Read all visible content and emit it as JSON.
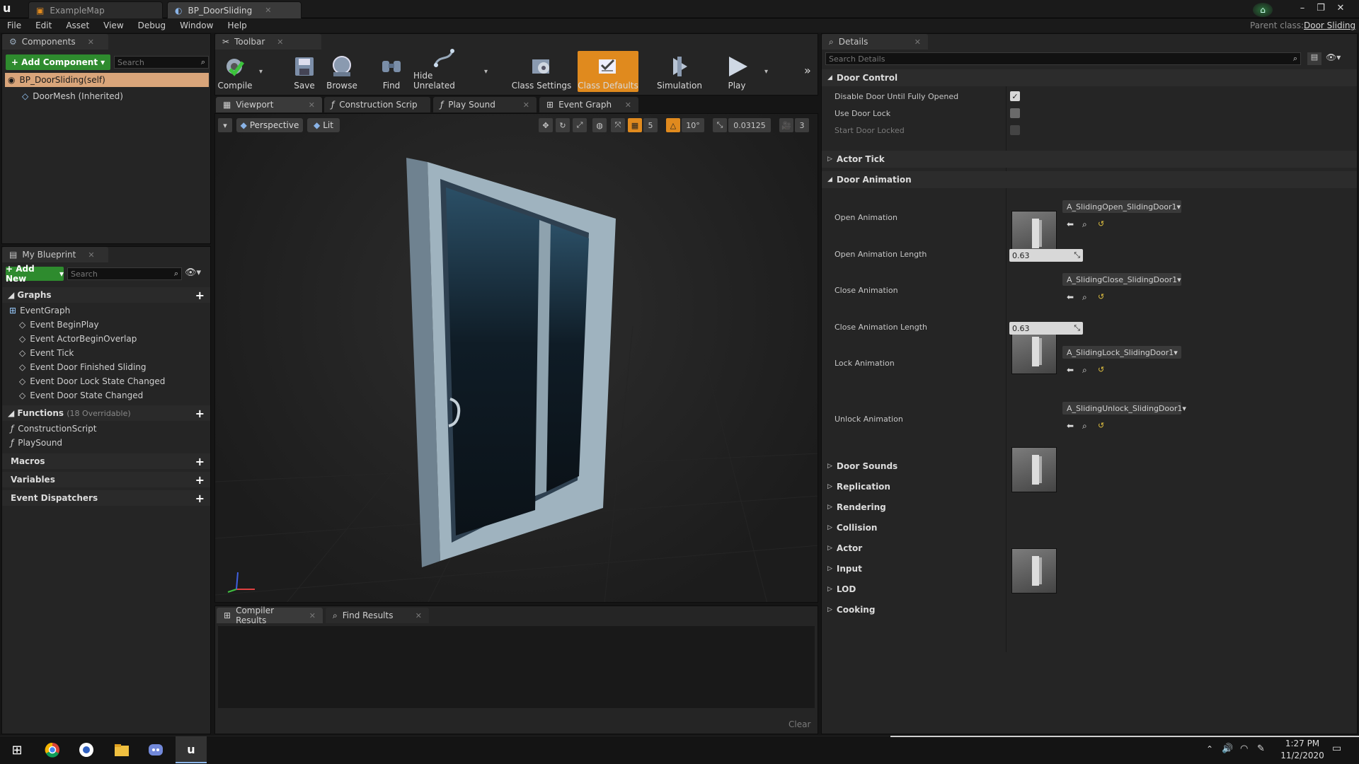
{
  "title_tabs": [
    {
      "label": "ExampleMap"
    },
    {
      "label": "BP_DoorSliding"
    }
  ],
  "parent_class": {
    "label": "Parent class:",
    "value": "Door Sliding"
  },
  "menu": [
    "File",
    "Edit",
    "Asset",
    "View",
    "Debug",
    "Window",
    "Help"
  ],
  "components": {
    "tab": "Components",
    "add_label": "+ Add Component",
    "search_placeholder": "Search",
    "root": "BP_DoorSliding(self)",
    "child": "DoorMesh (Inherited)"
  },
  "my_blueprint": {
    "tab": "My Blueprint",
    "add_label": "+ Add New",
    "search_placeholder": "Search",
    "graphs_header": "Graphs",
    "event_graph": "EventGraph",
    "events": [
      "Event BeginPlay",
      "Event ActorBeginOverlap",
      "Event Tick",
      "Event Door Finished Sliding",
      "Event Door Lock State Changed",
      "Event Door State Changed"
    ],
    "functions_header": "Functions",
    "functions_count": "(18 Overridable)",
    "functions": [
      "ConstructionScript",
      "PlaySound"
    ],
    "macros": "Macros",
    "variables": "Variables",
    "dispatchers": "Event Dispatchers"
  },
  "toolbar": {
    "tab": "Toolbar",
    "buttons": [
      "Compile",
      "Save",
      "Browse",
      "Find",
      "Hide Unrelated",
      "Class Settings",
      "Class Defaults",
      "Simulation",
      "Play"
    ]
  },
  "editor_tabs": [
    "Viewport",
    "Construction Scrip",
    "Play Sound",
    "Event Graph"
  ],
  "viewport": {
    "perspective": "Perspective",
    "lit": "Lit",
    "grid_snap": "5",
    "rot_snap": "10°",
    "scale_snap": "0.03125",
    "cam_speed": "3"
  },
  "bottom_tabs": [
    "Compiler Results",
    "Find Results"
  ],
  "clear_label": "Clear",
  "details": {
    "tab": "Details",
    "search_placeholder": "Search Details",
    "door_control": "Door Control",
    "props": [
      {
        "label": "Disable Door Until Fully Opened",
        "checked": true
      },
      {
        "label": "Use Door Lock",
        "checked": false
      },
      {
        "label": "Start Door Locked",
        "checked": false
      }
    ],
    "actor_tick": "Actor Tick",
    "door_animation": "Door Animation",
    "open_anim_label": "Open Animation",
    "open_anim_asset": "A_SlidingOpen_SlidingDoor1",
    "open_len_label": "Open Animation Length",
    "open_len_value": "0.63",
    "close_anim_label": "Close Animation",
    "close_anim_asset": "A_SlidingClose_SlidingDoor1",
    "close_len_label": "Close Animation Length",
    "close_len_value": "0.63",
    "lock_anim_label": "Lock Animation",
    "lock_anim_asset": "A_SlidingLock_SlidingDoor1",
    "unlock_anim_label": "Unlock Animation",
    "unlock_anim_asset": "A_SlidingUnlock_SlidingDoor1",
    "collapsed_sections": [
      "Door Sounds",
      "Replication",
      "Rendering",
      "Collision",
      "Actor",
      "Input",
      "LOD",
      "Cooking"
    ]
  },
  "taskbar": {
    "time": "1:27 PM",
    "date": "11/2/2020"
  },
  "colors": {
    "accent_orange": "#e08a1e",
    "green": "#2e8b2e",
    "selection": "#d9a57a"
  }
}
